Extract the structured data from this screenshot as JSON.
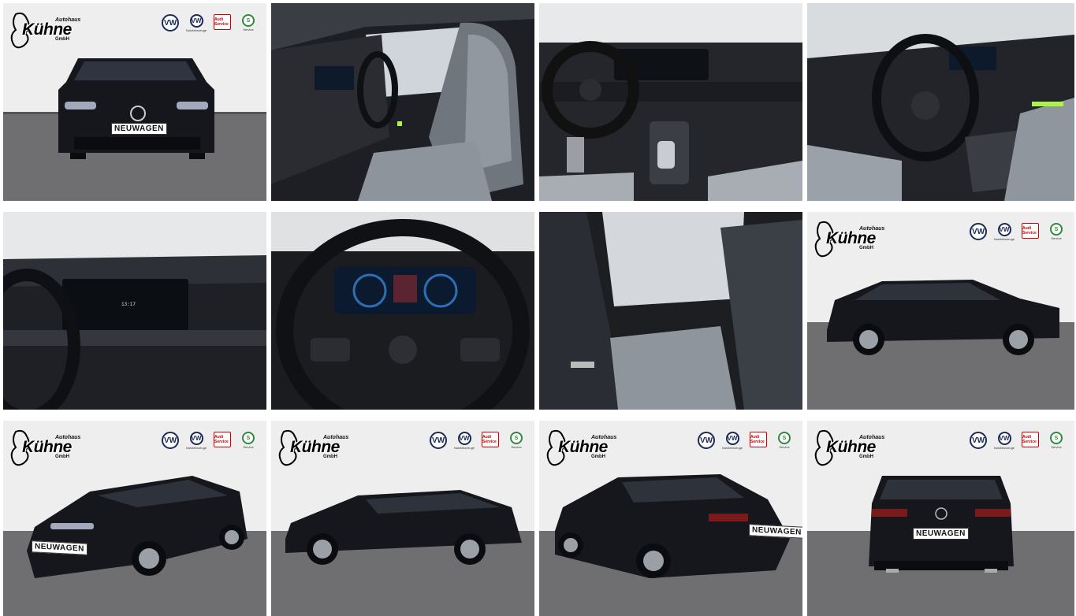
{
  "gallery": {
    "dealer": {
      "small_label": "Autohaus",
      "name": "Kühne",
      "suffix": "GmbH"
    },
    "brands": [
      {
        "name": "vw",
        "glyph": "VW",
        "caption": ""
      },
      {
        "name": "vw-nutzfahrzeuge",
        "glyph": "VW",
        "caption": "Nutzfahrzeuge"
      },
      {
        "name": "audi-service",
        "glyph": "Audi Service",
        "caption": ""
      },
      {
        "name": "skoda-service",
        "glyph": "S",
        "caption": "Service"
      }
    ],
    "plate_text": "NEUWAGEN",
    "clock_text": "13:17",
    "colors": {
      "car_body": "#15171c",
      "floor": "#6f6f72",
      "wall": "#eeeeee",
      "interior": "#2a2c31",
      "seat_fabric": "#9aa1a8",
      "ambient_green": "#aef24a",
      "cluster_blue": "#2d6fb5"
    },
    "tiles": [
      {
        "id": 1,
        "view": "front"
      },
      {
        "id": 2,
        "view": "interior-driver-seat"
      },
      {
        "id": 3,
        "view": "dashboard-center-console"
      },
      {
        "id": 4,
        "view": "steering-wheel-angle"
      },
      {
        "id": 5,
        "view": "infotainment-screen"
      },
      {
        "id": 6,
        "view": "instrument-cluster"
      },
      {
        "id": 7,
        "view": "rear-seats"
      },
      {
        "id": 8,
        "view": "side-right"
      },
      {
        "id": 9,
        "view": "front-left-three-quarter"
      },
      {
        "id": 10,
        "view": "side-left"
      },
      {
        "id": 11,
        "view": "rear-left-three-quarter"
      },
      {
        "id": 12,
        "view": "rear"
      }
    ]
  }
}
